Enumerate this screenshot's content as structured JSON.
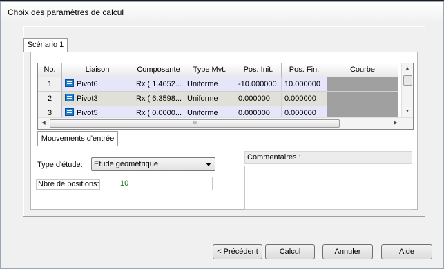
{
  "window": {
    "title": "Choix des paramètres de calcul"
  },
  "scenario_tab": {
    "label": "Scénario 1"
  },
  "grid": {
    "columns": [
      "No.",
      "Liaison",
      "Composante",
      "Type Mvt.",
      "Pos. Init.",
      "Pos. Fin.",
      "Courbe"
    ],
    "rows": [
      {
        "no": "1",
        "liaison": "Pivot6",
        "composante": "Rx ( 1.4652...",
        "type_mvt": "Uniforme",
        "pos_init": "-10.000000",
        "pos_fin": "10.000000"
      },
      {
        "no": "2",
        "liaison": "Pivot3",
        "composante": "Rx ( 6.3598...",
        "type_mvt": "Uniforme",
        "pos_init": "0.000000",
        "pos_fin": "0.000000"
      },
      {
        "no": "3",
        "liaison": "Pivot5",
        "composante": "Rx ( 0.0000...",
        "type_mvt": "Uniforme",
        "pos_init": "0.000000",
        "pos_fin": "0.000000"
      }
    ],
    "icons": {
      "liaison": "link-icon",
      "scroll_up": "arrow-up-icon",
      "scroll_down": "arrow-down-icon",
      "scroll_left": "arrow-left-icon",
      "scroll_right": "arrow-right-icon"
    },
    "hscroll_grip": "III"
  },
  "tabs2": {
    "mouvements": "Mouvements d'entrée"
  },
  "form": {
    "type_etude_label": "Type d'étude:",
    "type_etude_value": "Etude géométrique",
    "nbre_positions_label": "Nbre de positions:",
    "nbre_positions_value": "10",
    "commentaires_label": "Commentaires :",
    "commentaires_value": ""
  },
  "buttons": {
    "precedent": "< Précédent",
    "calcul": "Calcul",
    "annuler": "Annuler",
    "aide": "Aide"
  },
  "colors": {
    "row_blue": "#e6e6fa",
    "row_gray": "#e0e0d8",
    "curve_cell": "#a0a0a0",
    "value_green": "#1a7a1a",
    "icon_blue": "#1f7fd0"
  }
}
